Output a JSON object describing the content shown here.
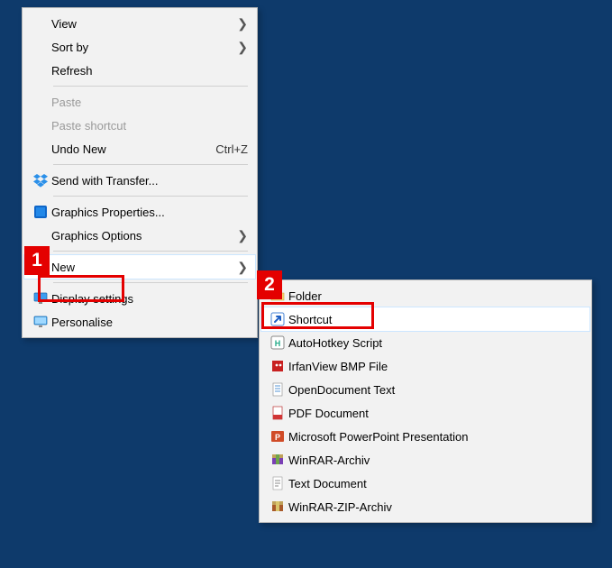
{
  "annotations": {
    "one": "1",
    "two": "2"
  },
  "main_menu": {
    "view": "View",
    "sort_by": "Sort by",
    "refresh": "Refresh",
    "paste": "Paste",
    "paste_shortcut": "Paste shortcut",
    "undo_new": "Undo New",
    "undo_new_accel": "Ctrl+Z",
    "send_with_transfer": "Send with Transfer...",
    "graphics_properties": "Graphics Properties...",
    "graphics_options": "Graphics Options",
    "new": "New",
    "display_settings": "Display settings",
    "personalise": "Personalise"
  },
  "new_submenu": {
    "folder": "Folder",
    "shortcut": "Shortcut",
    "autohotkey": "AutoHotkey Script",
    "irfanview_bmp": "IrfanView BMP File",
    "open_document_text": "OpenDocument Text",
    "pdf_document": "PDF Document",
    "powerpoint": "Microsoft PowerPoint Presentation",
    "winrar_archiv": "WinRAR-Archiv",
    "text_document": "Text Document",
    "winrar_zip_archiv": "WinRAR-ZIP-Archiv"
  }
}
